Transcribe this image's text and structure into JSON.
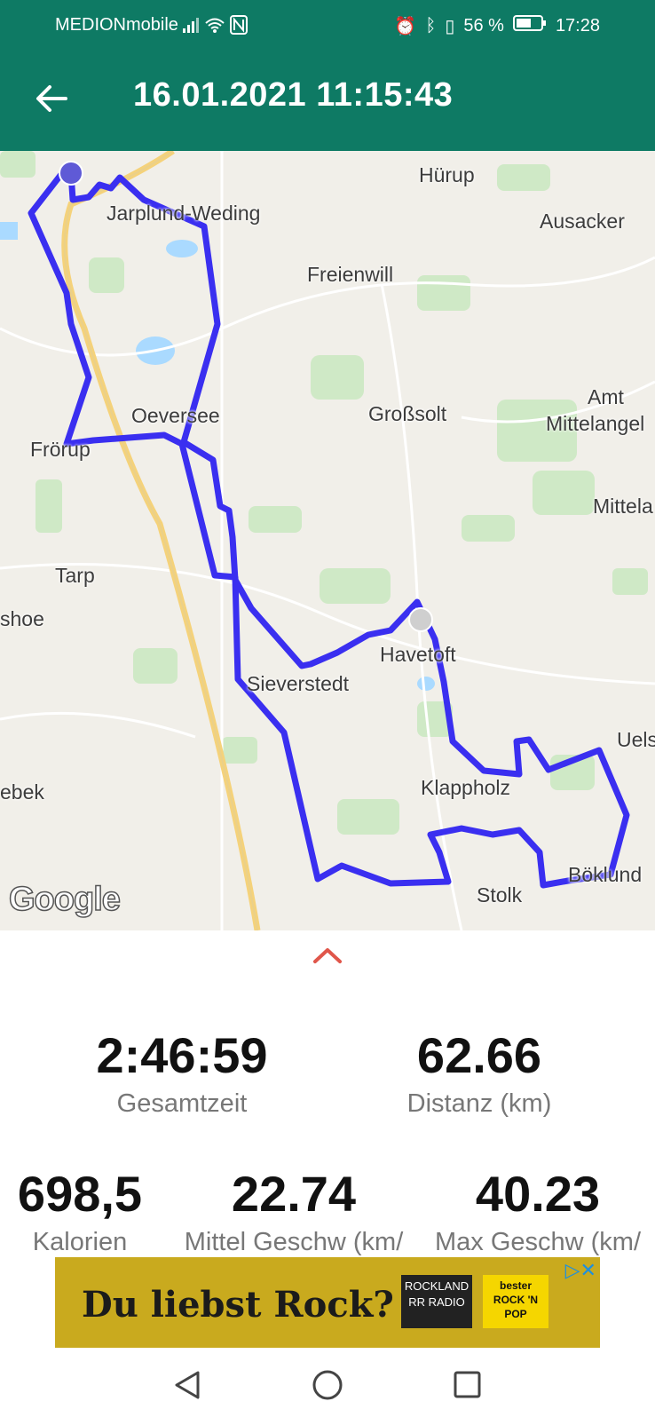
{
  "status_bar": {
    "carrier": "MEDIONmobile",
    "battery": "56 %",
    "time": "17:28"
  },
  "app_bar": {
    "title": "16.01.2021 11:15:43"
  },
  "map": {
    "places": [
      {
        "name": "Hürup"
      },
      {
        "name": "Jarplund-Weding"
      },
      {
        "name": "Ausacker"
      },
      {
        "name": "Freienwill"
      },
      {
        "name": "Amt"
      },
      {
        "name": "Mittelangel"
      },
      {
        "name": "Oeversee"
      },
      {
        "name": "Großsolt"
      },
      {
        "name": "Frörup"
      },
      {
        "name": "Mittela"
      },
      {
        "name": "Tarp"
      },
      {
        "name": "shoe"
      },
      {
        "name": "Havetoft"
      },
      {
        "name": "Sieverstedt"
      },
      {
        "name": "Uels"
      },
      {
        "name": "Klappholz"
      },
      {
        "name": "ebek"
      },
      {
        "name": "Böklund"
      },
      {
        "name": "Stolk"
      }
    ],
    "attribution": "Google",
    "route_color": "#3a2ff0"
  },
  "stats": {
    "total_time": {
      "value": "2:46:59",
      "label": "Gesamtzeit"
    },
    "distance": {
      "value": "62.66",
      "label": "Distanz (km)"
    },
    "calories": {
      "value": "698,5",
      "label": "Kalorien"
    },
    "avg_speed": {
      "value": "22.74",
      "label": "Mittel Geschw (km/"
    },
    "max_speed": {
      "value": "40.23",
      "label": "Max Geschw (km/"
    }
  },
  "ad": {
    "text": "Du liebst Rock?",
    "logo1": "ROCKLAND RR RADIO",
    "logo2": "bester ROCK 'N POP"
  }
}
